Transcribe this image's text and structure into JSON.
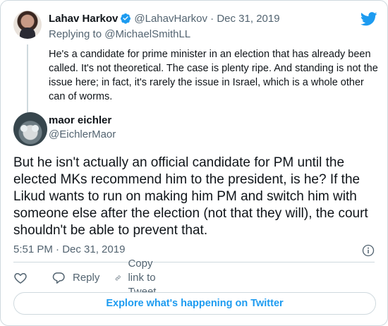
{
  "parent_tweet": {
    "author_name": "Lahav Harkov",
    "author_handle": "@LahavHarkov",
    "separator": "·",
    "date": "Dec 31, 2019",
    "replying_to": "Replying to @MichaelSmithLL",
    "text": "He's a candidate for prime minister in an election that has already been called. It's not theoretical. The case is plenty ripe. And standing is not the issue here; in fact, it's rarely the issue in Israel, which is a whole other can of worms."
  },
  "main_tweet": {
    "author_name": "maor eichler",
    "author_handle": "@EichlerMaor",
    "text": "But he isn't actually an official candidate for PM until the elected MKs recommend him to the president, is he? If the Likud wants to run on making him PM and switch him with someone else after the election (not that they will), the court shouldn't be able to prevent that.",
    "timestamp": "5:51 PM · Dec 31, 2019"
  },
  "actions": {
    "reply_label": "Reply",
    "copy_link_label": "Copy link to Tweet"
  },
  "explore_label": "Explore what's happening on Twitter",
  "colors": {
    "brand_blue": "#1d9bf0",
    "secondary_text": "#536471",
    "border": "#cfd9de"
  },
  "icons": [
    "twitter-bird-icon",
    "verified-badge-icon",
    "info-icon",
    "heart-icon",
    "reply-icon",
    "link-icon"
  ]
}
